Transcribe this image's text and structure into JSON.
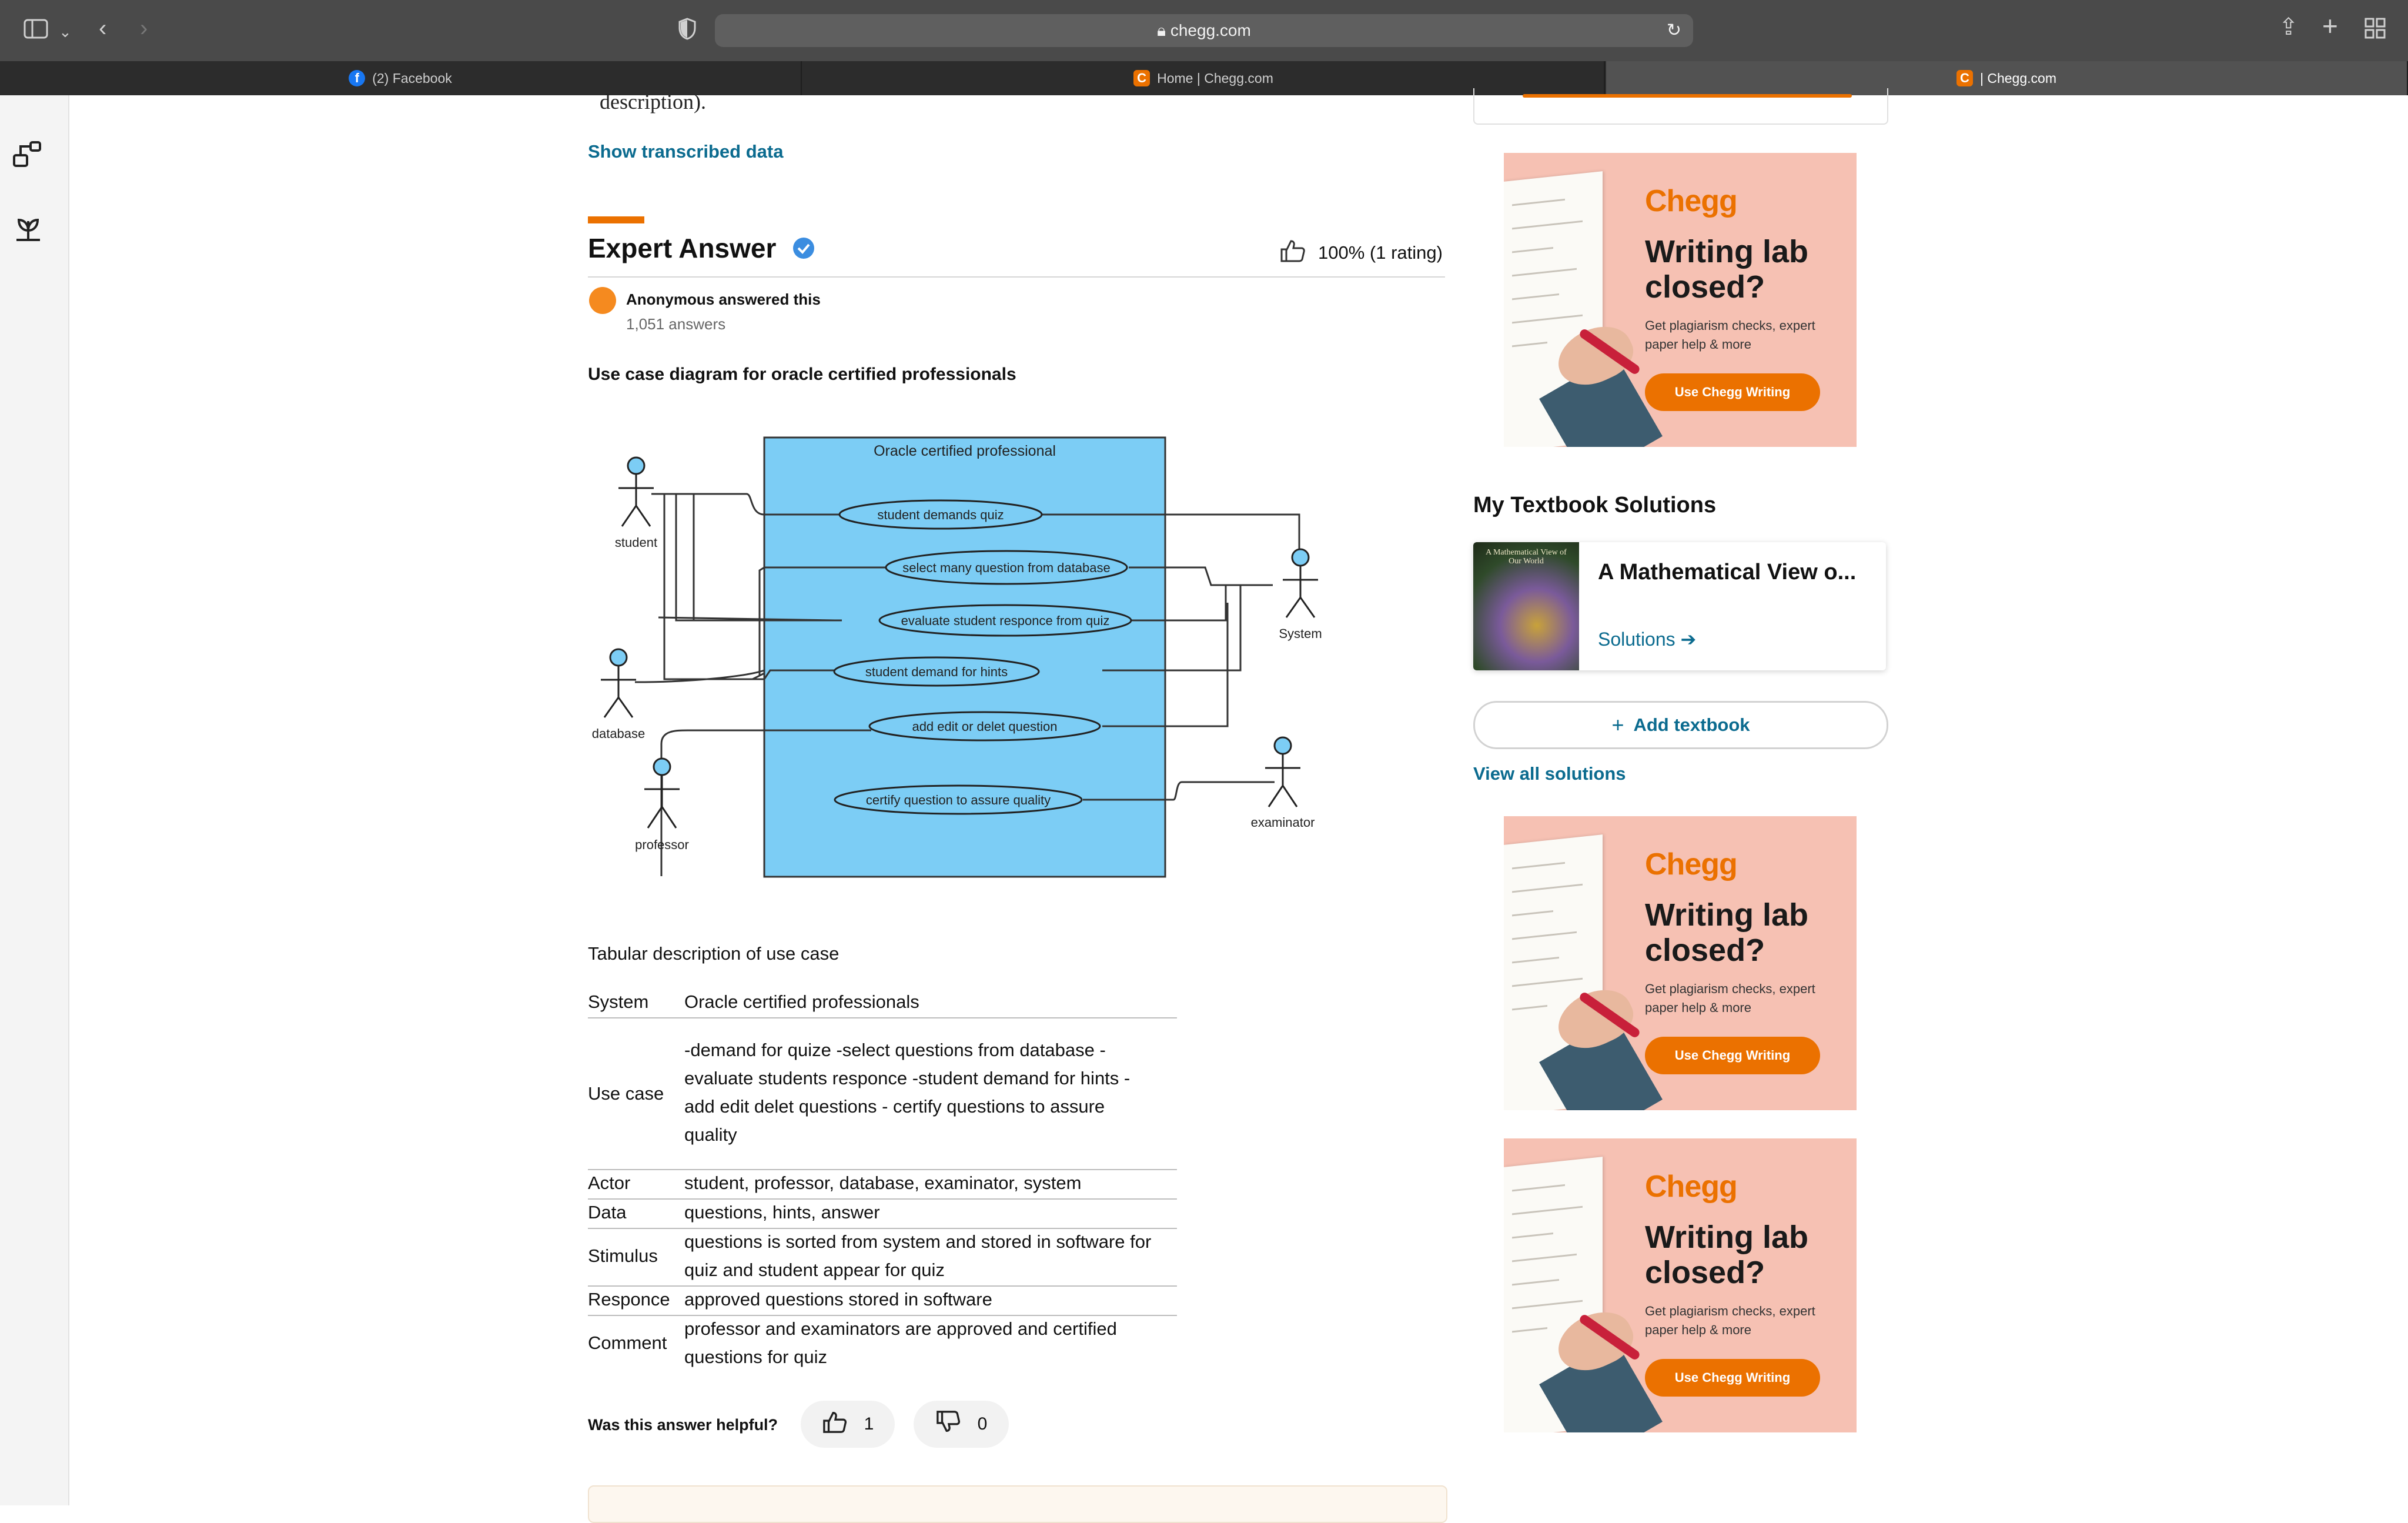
{
  "browser": {
    "url": "chegg.com",
    "tabs": [
      {
        "label": "(2) Facebook",
        "favicon": "facebook-icon"
      },
      {
        "label": "Home | Chegg.com",
        "favicon": "chegg-icon"
      },
      {
        "label": "| Chegg.com",
        "favicon": "chegg-icon",
        "active": true
      }
    ]
  },
  "question": {
    "cut_text": "description).",
    "show_transcribed": "Show transcribed data"
  },
  "answer": {
    "title": "Expert Answer",
    "rating": "100% (1 rating)",
    "author": "Anonymous answered this",
    "answers_count": "1,051 answers",
    "heading": "Use case diagram for oracle certified professionals"
  },
  "diagram": {
    "system_title": "Oracle certified professional",
    "actors": [
      "student",
      "database",
      "professor",
      "System",
      "examinator"
    ],
    "use_cases": [
      "student demands quiz",
      "select many question from database",
      "evaluate student responce from quiz",
      "student demand for hints",
      "add edit or delet question",
      "certify question to assure quality"
    ]
  },
  "table": {
    "title": "Tabular description of use case",
    "rows": [
      {
        "label": "System",
        "lines": [
          "Oracle certified professionals"
        ]
      },
      {
        "label": "Use case",
        "lines": [
          "-demand for quize -select questions from database -",
          "evaluate students responce -student demand for hints -",
          "add edit delet questions - certify questions to assure",
          "quality"
        ]
      },
      {
        "label": "Actor",
        "lines": [
          "student, professor, database, examinator, system"
        ]
      },
      {
        "label": "Data",
        "lines": [
          "questions, hints, answer"
        ]
      },
      {
        "label": "Stimulus",
        "lines": [
          "questions is sorted from system and stored in software for",
          "quiz and student appear for quiz"
        ]
      },
      {
        "label": "Responce",
        "lines": [
          "approved questions stored in software"
        ]
      },
      {
        "label": "Comment",
        "lines": [
          "professor and examinators are approved and certified",
          "questions for quiz"
        ]
      }
    ]
  },
  "feedback": {
    "question": "Was this answer helpful?",
    "likes": "1",
    "dislikes": "0"
  },
  "sidebar": {
    "textbook_heading": "My Textbook Solutions",
    "book_title": "A Mathematical View o...",
    "book_cover_text": "A Mathematical View of Our World",
    "solutions_link": "Solutions ➔",
    "add_textbook": "Add textbook",
    "view_all": "View all solutions"
  },
  "ad": {
    "brand": "Chegg",
    "headline": "Writing lab closed?",
    "sub": "Get plagiarism checks, expert paper help & more",
    "button": "Use Chegg Writing"
  },
  "colors": {
    "accent": "#eb7100",
    "link": "#0b6b8f",
    "diagram_fill": "#7ccdf5",
    "ad_bg": "#f6c1b3"
  }
}
